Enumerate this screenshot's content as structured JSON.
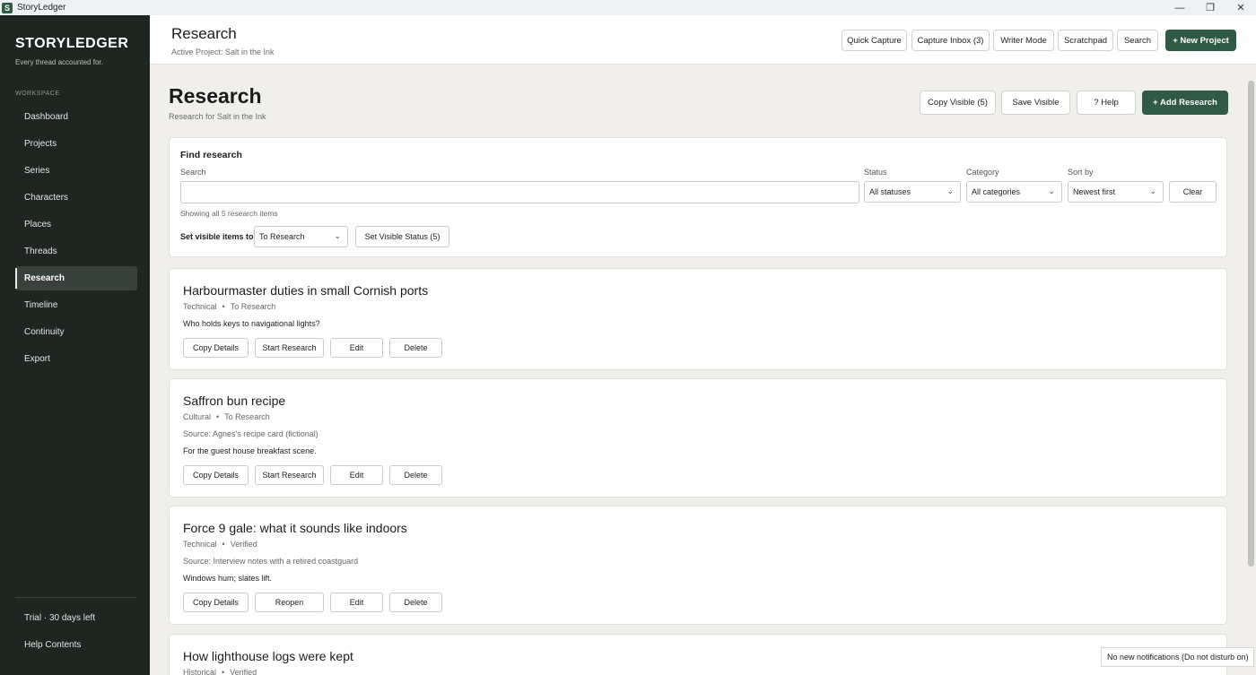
{
  "window": {
    "title": "StoryLedger",
    "app_icon_letter": "S",
    "controls": {
      "minimize": "—",
      "restore": "❐",
      "close": "✕"
    }
  },
  "sidebar": {
    "brand": "STORYLEDGER",
    "tagline": "Every thread accounted for.",
    "section": "WORKSPACE",
    "items": [
      {
        "label": "Dashboard"
      },
      {
        "label": "Projects"
      },
      {
        "label": "Series"
      },
      {
        "label": "Characters"
      },
      {
        "label": "Places"
      },
      {
        "label": "Threads"
      },
      {
        "label": "Research",
        "active": true
      },
      {
        "label": "Timeline"
      },
      {
        "label": "Continuity"
      },
      {
        "label": "Export"
      }
    ],
    "trial": "Trial · 30 days left",
    "help": "Help Contents"
  },
  "header": {
    "title": "Research",
    "subtitle": "Active Project: Salt in the Ink",
    "buttons": {
      "quick_capture": "Quick Capture",
      "capture_inbox": "Capture Inbox (3)",
      "writer_mode": "Writer Mode",
      "scratchpad": "Scratchpad",
      "search": "Search",
      "new_project": "+ New Project"
    }
  },
  "page": {
    "title": "Research",
    "subtitle": "Research for Salt in the Ink",
    "buttons": {
      "copy_visible": "Copy Visible (5)",
      "save_visible": "Save Visible",
      "help": "? Help",
      "add_research": "+ Add Research"
    }
  },
  "filters": {
    "title": "Find research",
    "search_label": "Search",
    "search_value": "",
    "status_label": "Status",
    "status_value": "All statuses",
    "category_label": "Category",
    "category_value": "All categories",
    "sort_label": "Sort by",
    "sort_value": "Newest first",
    "clear": "Clear",
    "showing": "Showing all 5 research items",
    "bulk_label": "Set visible items to",
    "bulk_value": "To Research",
    "bulk_button": "Set Visible Status (5)"
  },
  "items": [
    {
      "title": "Harbourmaster duties in small Cornish ports",
      "category": "Technical",
      "status": "To Research",
      "source": "",
      "note": "Who holds keys to navigational lights?",
      "buttons": [
        "Copy Details",
        "Start Research",
        "Edit",
        "Delete"
      ]
    },
    {
      "title": "Saffron bun recipe",
      "category": "Cultural",
      "status": "To Research",
      "source": "Source: Agnes's recipe card (fictional)",
      "note": "For the guest house breakfast scene.",
      "buttons": [
        "Copy Details",
        "Start Research",
        "Edit",
        "Delete"
      ]
    },
    {
      "title": "Force 9 gale: what it sounds like indoors",
      "category": "Technical",
      "status": "Verified",
      "source": "Source: Interview notes with a retired coastguard",
      "note": "Windows hum; slates lift.",
      "buttons": [
        "Copy Details",
        "Reopen",
        "Edit",
        "Delete"
      ]
    },
    {
      "title": "How lighthouse logs were kept",
      "category": "Historical",
      "status": "Verified",
      "source": "",
      "note": "",
      "buttons": []
    }
  ],
  "meta_separator": "•",
  "toast": "No new notifications (Do not disturb on)"
}
